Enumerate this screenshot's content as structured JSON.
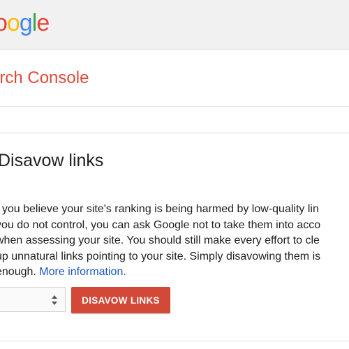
{
  "header": {
    "logo_letters": [
      {
        "char": "o",
        "color": "#ea4335"
      },
      {
        "char": "o",
        "color": "#fbbc05"
      },
      {
        "char": "g",
        "color": "#4285f4"
      },
      {
        "char": "l",
        "color": "#34a853"
      },
      {
        "char": "e",
        "color": "#ea4335"
      }
    ]
  },
  "product": {
    "title": "arch Console"
  },
  "card": {
    "title": "Disavow links",
    "description_lines": [
      "f you believe your site's ranking is being harmed by low-quality lin",
      "you do not control, you can ask Google not to take them into acco",
      "when assessing your site. You should still make every effort to cle",
      "up unnatural links pointing to your site. Simply disavowing them is"
    ],
    "last_line_text": "enough.",
    "more_info_link": "More information.",
    "site_select_value": "",
    "disavow_button": "DISAVOW LINKS"
  },
  "colors": {
    "accent_red": "#d34836",
    "link_blue": "#1a55c8",
    "product_title_red": "#dd4b39"
  }
}
